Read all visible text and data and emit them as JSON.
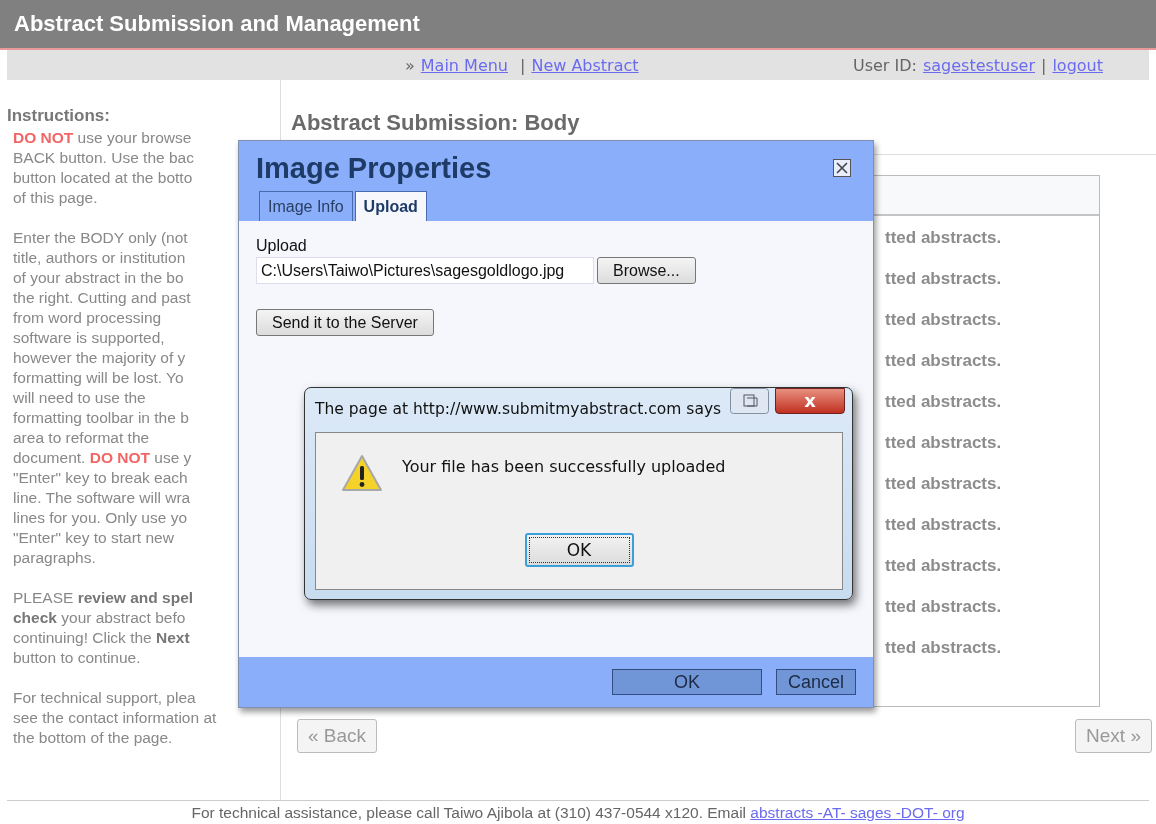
{
  "header": {
    "title": "Abstract Submission and Management"
  },
  "nav": {
    "prefix": "»",
    "links": [
      {
        "label": "Main Menu"
      },
      {
        "label": "New Abstract"
      }
    ],
    "separator": "|",
    "user_label": "User ID:",
    "user_link": "sagestestuser",
    "user_separator": "|",
    "logout": "logout"
  },
  "instructions": {
    "title": "Instructions:",
    "paragraphs": [
      [
        [
          {
            "kind": "warning",
            "text": "DO NOT"
          },
          {
            "kind": "plain",
            "text": " use your browse"
          }
        ],
        [
          {
            "kind": "plain",
            "text": "BACK button. Use the bac"
          }
        ],
        [
          {
            "kind": "plain",
            "text": "button located at the botto"
          }
        ],
        [
          {
            "kind": "plain",
            "text": "of this page."
          }
        ]
      ],
      [
        [
          {
            "kind": "plain",
            "text": "Enter the BODY only (not"
          }
        ],
        [
          {
            "kind": "plain",
            "text": "title, authors or institution"
          }
        ],
        [
          {
            "kind": "plain",
            "text": "of your abstract in the bo"
          }
        ],
        [
          {
            "kind": "plain",
            "text": "the right. Cutting and past"
          }
        ],
        [
          {
            "kind": "plain",
            "text": "from word processing"
          }
        ],
        [
          {
            "kind": "plain",
            "text": "software is supported,"
          }
        ],
        [
          {
            "kind": "plain",
            "text": "however the majority of y"
          }
        ],
        [
          {
            "kind": "plain",
            "text": "formatting will be lost. Yo"
          }
        ],
        [
          {
            "kind": "plain",
            "text": "will need to use the"
          }
        ],
        [
          {
            "kind": "plain",
            "text": "formatting toolbar in the b"
          }
        ],
        [
          {
            "kind": "plain",
            "text": "area to reformat the"
          }
        ],
        [
          {
            "kind": "plain",
            "text": "document. "
          },
          {
            "kind": "warning",
            "text": "DO NOT"
          },
          {
            "kind": "plain",
            "text": " use y"
          }
        ],
        [
          {
            "kind": "plain",
            "text": "\"Enter\" key to break each"
          }
        ],
        [
          {
            "kind": "plain",
            "text": "line. The software will wra"
          }
        ],
        [
          {
            "kind": "plain",
            "text": "lines for you. Only use yo"
          }
        ],
        [
          {
            "kind": "plain",
            "text": "\"Enter\" key to start new"
          }
        ],
        [
          {
            "kind": "plain",
            "text": "paragraphs."
          }
        ]
      ],
      [
        [
          {
            "kind": "plain",
            "text": "PLEASE "
          },
          {
            "kind": "bold",
            "text": "review and spel"
          }
        ],
        [
          {
            "kind": "bold",
            "text": "check"
          },
          {
            "kind": "plain",
            "text": " your abstract befo"
          }
        ],
        [
          {
            "kind": "plain",
            "text": "continuing! Click the "
          },
          {
            "kind": "bold",
            "text": "Next"
          }
        ],
        [
          {
            "kind": "plain",
            "text": "button to continue."
          }
        ]
      ],
      [
        [
          {
            "kind": "plain",
            "text": "For technical support, plea"
          }
        ],
        [
          {
            "kind": "plain",
            "text": "see the contact information at"
          }
        ],
        [
          {
            "kind": "plain",
            "text": "the bottom of the page."
          }
        ]
      ]
    ]
  },
  "content": {
    "heading": "Abstract Submission: Body",
    "editor_lines": [
      "tted abstracts.",
      "tted abstracts.",
      "tted abstracts.",
      "tted abstracts.",
      "tted abstracts.",
      "tted abstracts.",
      "tted abstracts.",
      "tted abstracts.",
      "tted abstracts.",
      "tted abstracts.",
      "tted abstracts."
    ],
    "back_button": "« Back",
    "next_button": "Next »"
  },
  "footer": {
    "text": "For technical assistance, please call Taiwo Ajibola at (310) 437-0544 x120. Email ",
    "link": "abstracts -AT- sages -DOT- org"
  },
  "image_dialog": {
    "title": "Image Properties",
    "tabs": [
      {
        "label": "Image Info",
        "selected": false
      },
      {
        "label": "Upload",
        "selected": true
      }
    ],
    "upload_label": "Upload",
    "file_value": "C:\\Users\\Taiwo\\Pictures\\sagesgoldlogo.jpg",
    "browse_button": "Browse...",
    "send_button": "Send it to the Server",
    "ok_button": "OK",
    "cancel_button": "Cancel"
  },
  "alert": {
    "title": "The page at http://www.submitmyabstract.com says",
    "close_glyph": "x",
    "message": "Your file has been successfully uploaded",
    "ok_button": "OK"
  }
}
